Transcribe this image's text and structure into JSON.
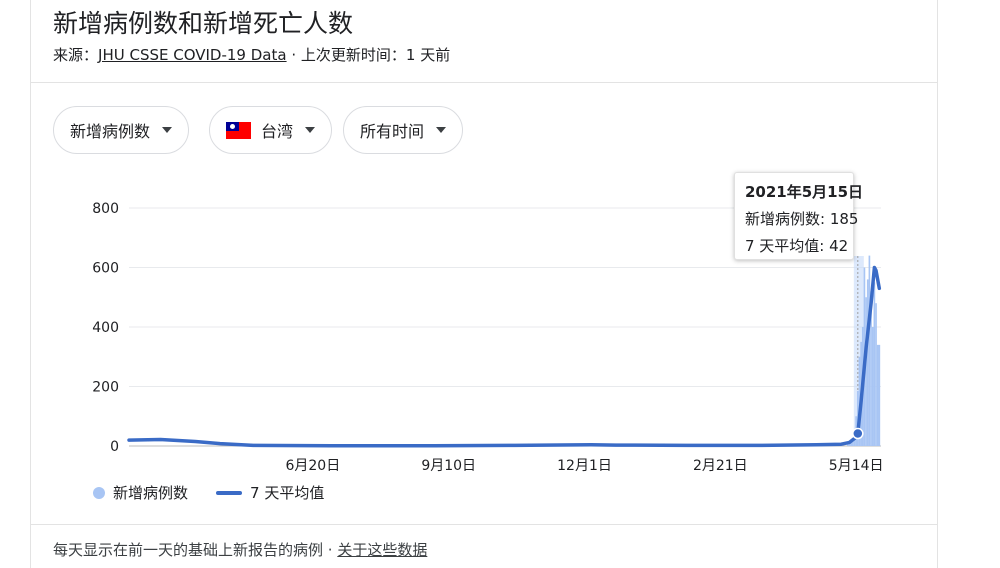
{
  "header": {
    "title": "新增病例数和新增死亡人数",
    "source_prefix": "来源：",
    "source_link": "JHU CSSE COVID-19 Data",
    "source_suffix": " · 上次更新时间：1 天前"
  },
  "filters": {
    "metric": "新增病例数",
    "region": "台湾",
    "region_flag": "taiwan-flag-icon",
    "time_range": "所有时间"
  },
  "tooltip": {
    "date": "2021年5月15日",
    "cases_line": "新增病例数: 185",
    "avg_line": "7 天平均值: 42"
  },
  "legend": {
    "cases": "新增病例数",
    "avg": "7 天平均值"
  },
  "footer": {
    "note": "每天显示在前一天的基础上新报告的病例 · ",
    "link": "关于这些数据"
  },
  "colors": {
    "bar": "#a8c5f4",
    "line": "#3a6bc6",
    "grid": "#e8eaed",
    "highlight": "#c7dafa"
  },
  "chart_data": {
    "type": "bar",
    "title": "",
    "xlabel": "",
    "ylabel": "",
    "ylim": [
      0,
      800
    ],
    "y_ticks": [
      0,
      200,
      400,
      600,
      800
    ],
    "x_tick_labels": [
      "6月20日",
      "9月10日",
      "12月1日",
      "2月21日",
      "5月14日"
    ],
    "x_tick_dates": [
      "2020-06-20",
      "2020-09-10",
      "2020-12-01",
      "2021-02-21",
      "2021-05-14"
    ],
    "x_range": [
      "2020-03-01",
      "2021-05-29"
    ],
    "highlight_date": "2021-05-15",
    "grid": true,
    "legend_position": "bottom-left",
    "series": [
      {
        "name": "新增病例数",
        "type": "bar",
        "points": [
          [
            "2021-05-09",
            10
          ],
          [
            "2021-05-10",
            15
          ],
          [
            "2021-05-11",
            20
          ],
          [
            "2021-05-12",
            16
          ],
          [
            "2021-05-13",
            30
          ],
          [
            "2021-05-14",
            100
          ],
          [
            "2021-05-15",
            185
          ],
          [
            "2021-05-16",
            300
          ],
          [
            "2021-05-17",
            350
          ],
          [
            "2021-05-18",
            400
          ],
          [
            "2021-05-19",
            600
          ],
          [
            "2021-05-20",
            500
          ],
          [
            "2021-05-21",
            560
          ],
          [
            "2021-05-22",
            640
          ],
          [
            "2021-05-23",
            520
          ],
          [
            "2021-05-24",
            400
          ],
          [
            "2021-05-25",
            550
          ],
          [
            "2021-05-26",
            480
          ],
          [
            "2021-05-27",
            340
          ],
          [
            "2021-05-28",
            340
          ]
        ]
      },
      {
        "name": "7 天平均值",
        "type": "line",
        "points": [
          [
            "2020-03-01",
            20
          ],
          [
            "2020-03-20",
            22
          ],
          [
            "2020-04-10",
            15
          ],
          [
            "2020-04-25",
            8
          ],
          [
            "2020-05-15",
            2
          ],
          [
            "2020-07-01",
            1
          ],
          [
            "2020-09-01",
            1
          ],
          [
            "2020-10-20",
            2
          ],
          [
            "2020-12-05",
            4
          ],
          [
            "2020-12-20",
            3
          ],
          [
            "2021-02-01",
            2
          ],
          [
            "2021-03-15",
            2
          ],
          [
            "2021-04-20",
            4
          ],
          [
            "2021-05-05",
            6
          ],
          [
            "2021-05-10",
            12
          ],
          [
            "2021-05-14",
            30
          ],
          [
            "2021-05-15",
            42
          ],
          [
            "2021-05-17",
            150
          ],
          [
            "2021-05-20",
            330
          ],
          [
            "2021-05-23",
            480
          ],
          [
            "2021-05-25",
            600
          ],
          [
            "2021-05-26",
            590
          ],
          [
            "2021-05-28",
            530
          ]
        ]
      }
    ]
  }
}
